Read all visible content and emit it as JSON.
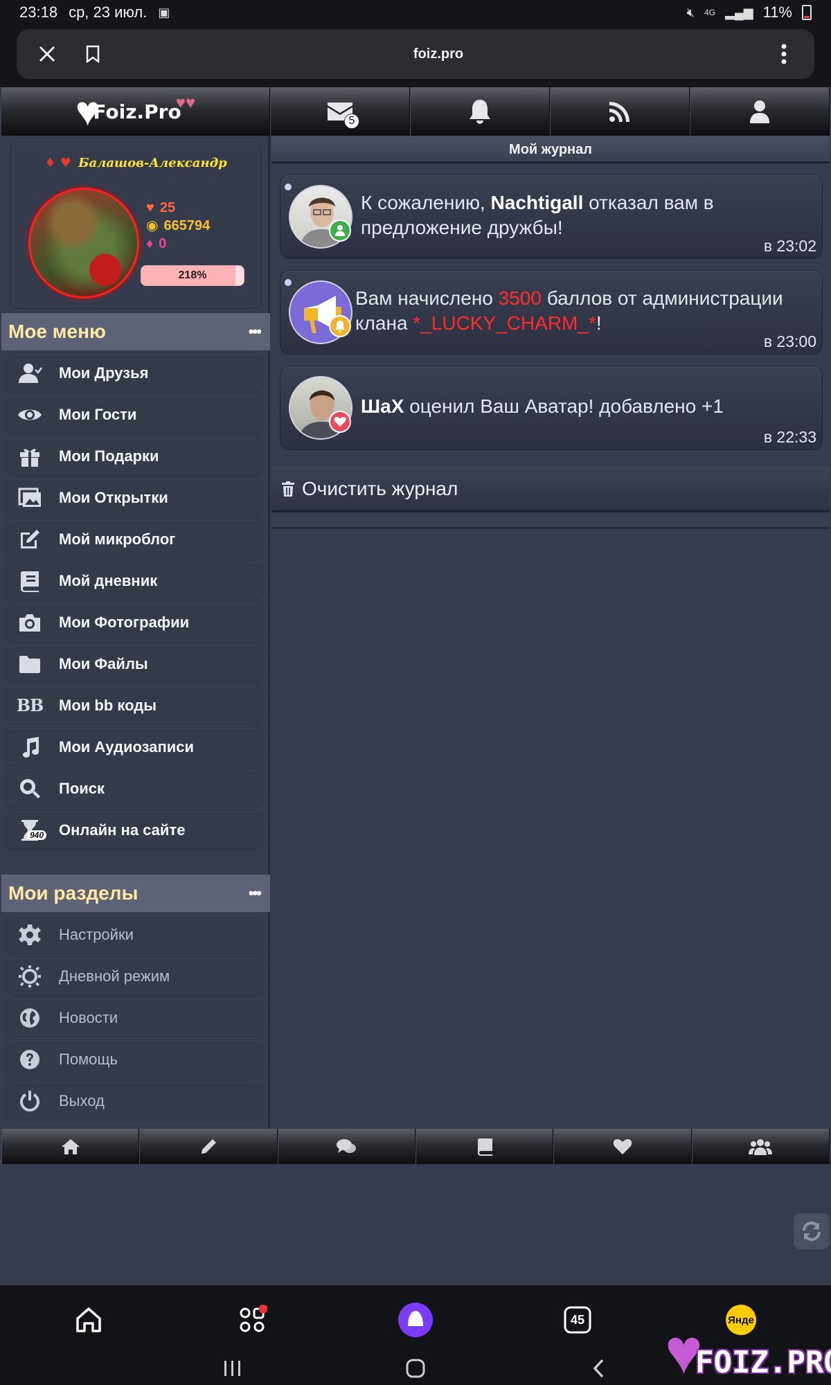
{
  "status_bar": {
    "time": "23:18",
    "date": "ср, 23 июл.",
    "network": "4G",
    "battery": "11%"
  },
  "browser": {
    "url": "foiz.pro"
  },
  "site": {
    "logo_text": "Foiz.Pro",
    "nav": {
      "mail_badge": "5"
    },
    "profile": {
      "name": "Балашов-Александр",
      "stat_likes": "25",
      "stat_coins": "665794",
      "stat_gems": "0",
      "progress_label": "218%",
      "progress_fraction": 0.92
    },
    "menu_header": "Мое меню",
    "menu_items": [
      {
        "label": "Мои Друзья",
        "icon": "user-friends-icon"
      },
      {
        "label": "Мои Гости",
        "icon": "eye-icon"
      },
      {
        "label": "Мои Подарки",
        "icon": "gift-icon"
      },
      {
        "label": "Мои Открытки",
        "icon": "postcards-icon"
      },
      {
        "label": "Мой микроблог",
        "icon": "edit-icon"
      },
      {
        "label": "Мой дневник",
        "icon": "book-icon"
      },
      {
        "label": "Мои Фотографии",
        "icon": "camera-icon"
      },
      {
        "label": "Мои Файлы",
        "icon": "folder-icon"
      },
      {
        "label": "Мои bb коды",
        "icon": "bb-icon"
      },
      {
        "label": "Мои Аудиозаписи",
        "icon": "music-icon"
      },
      {
        "label": "Поиск",
        "icon": "search-icon"
      },
      {
        "label": "Онлайн на сайте",
        "icon": "hourglass-icon",
        "badge": "940"
      }
    ],
    "sections_header": "Мои разделы",
    "section_items": [
      {
        "label": "Настройки",
        "icon": "gear-icon"
      },
      {
        "label": "Дневной режим",
        "icon": "sun-icon"
      },
      {
        "label": "Новости",
        "icon": "globe-icon"
      },
      {
        "label": "Помощь",
        "icon": "question-icon"
      },
      {
        "label": "Выход",
        "icon": "power-icon"
      }
    ],
    "journal": {
      "title": "Мой журнал",
      "notifications": [
        {
          "pre": "К сожалению, ",
          "bold": "Nachtigall",
          "post": " отказал вам в предложение дружбы!",
          "time": "в 23:02"
        },
        {
          "pre": "Вам начислено ",
          "red1": "3500",
          "mid": " баллов от администрации клана ",
          "red2": "*_LUCKY_CHARM_*",
          "post": "!",
          "time": "в 23:00"
        },
        {
          "bold": "ШаХ",
          "post": " оценил Ваш Аватар! добавлено +1",
          "time": "в 22:33"
        }
      ],
      "clear_label": "Очистить журнал"
    }
  },
  "dock": {
    "calendar_day": "45",
    "yandex_label": "Янде"
  },
  "watermark": "FOIZ.PRO",
  "colors": {
    "background": "#363c4e",
    "accent_yellow": "#ffe9a6",
    "red_text": "#ff2a2a"
  }
}
